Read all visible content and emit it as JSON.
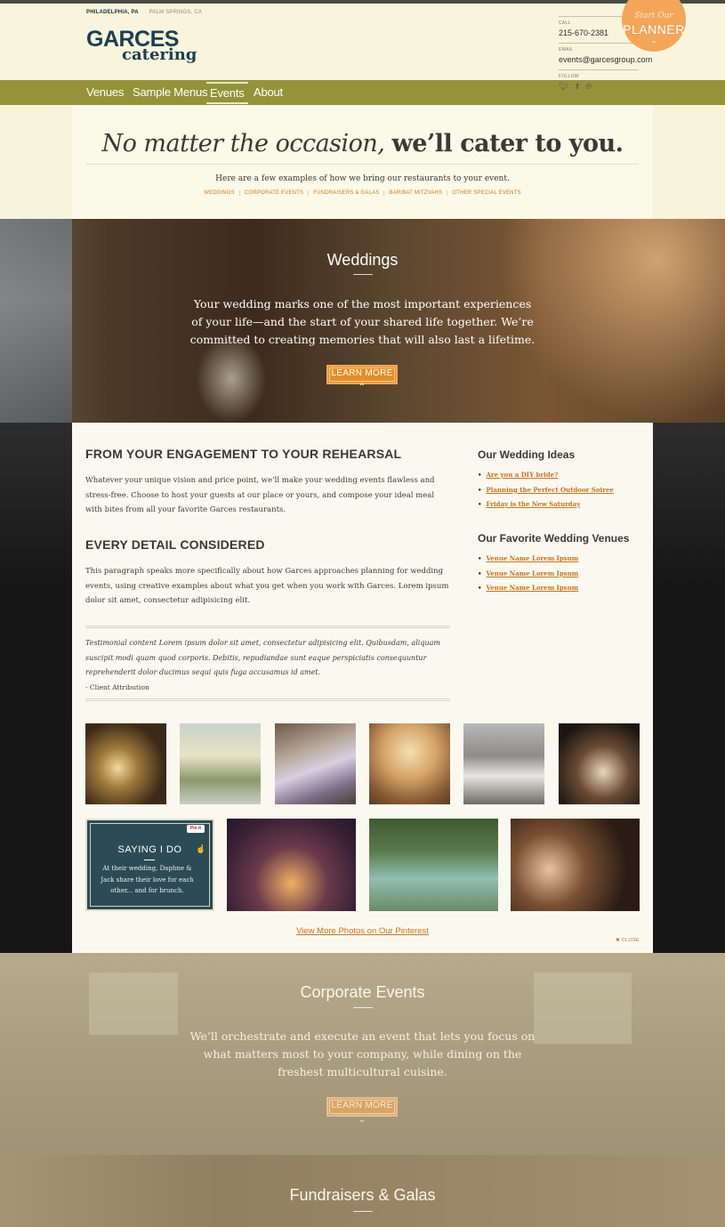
{
  "header": {
    "location_active": "PHILADELPHIA, PA",
    "location_other": "PALM SPRINGS, CA",
    "logo_line1": "GARCES",
    "logo_line2": "catering",
    "call_label": "CALL",
    "phone": "215-670-2381",
    "email_label": "EMAIL",
    "email": "events@garcesgroup.com",
    "follow_label": "FOLLOW",
    "social_icons": [
      "twitter-icon",
      "facebook-icon",
      "pinterest-icon"
    ],
    "planner": {
      "line1": "Start Our",
      "line2": "PLANNER",
      "arrow": "⌄"
    }
  },
  "nav": {
    "items": [
      "Venues",
      "Sample Menus",
      "Events",
      "About"
    ],
    "active": "Events"
  },
  "intro": {
    "headline_italic": "No matter the occasion,",
    "headline_bold": "we’ll cater to you.",
    "subtext": "Here are a few examples of how we bring our restaurants to your event.",
    "links": [
      "WEDDINGS",
      "CORPORATE EVENTS",
      "FUNDRAISERS & GALAS",
      "BAR/BAT MITZVAHS",
      "OTHER SPECIAL EVENTS"
    ]
  },
  "weddings": {
    "title": "Weddings",
    "body": "Your wedding marks one of the most important experiences of your life—and the start of your shared life together. We’re committed to creating memories that will also last a lifetime.",
    "button": "LEARN MORE ⌃",
    "section1_title": "FROM YOUR ENGAGEMENT TO YOUR REHEARSAL",
    "section1_body": "Whatever your unique vision and price point, we’ll make your wedding events flawless and stress-free. Choose to host your guests at our place or yours, and compose your ideal meal with bites from all your favorite Garces restaurants.",
    "section2_title": "EVERY DETAIL CONSIDERED",
    "section2_body": "This paragraph speaks more specifically about how Garces approaches planning for wedding events, using creative examples about what you get when you work with Garces. Lorem ipsum dolor sit amet, consectetur adipisicing elit.",
    "testimonial": "Testimonial content Lorem ipsum dolor sit amet, consectetur adipisicing elit. Quibusdam, aliquam suscipit modi quam quod corporis. Debitis, repudiandae sunt eaque perspiciatis consequuntur reprehenderit dolor ducimus sequi quis fuga accusamus id amet.",
    "attribution": "- Client Attribution",
    "ideas_title": "Our Wedding Ideas",
    "ideas": [
      "Are you a DIY bride?",
      "Planning the Perfect Outdoor Soiree",
      "Friday is the New Saturday"
    ],
    "venues_title": "Our Favorite Wedding Venues",
    "venues": [
      "Venue Name Lorem Ipsum",
      "Venue Name Lorem Ipsum",
      "Venue Name Lorem Ipsum"
    ],
    "pin_card": {
      "pinit": "Pin it",
      "title": "SAYING I DO",
      "desc": "At their wedding, Daphne & Jack share their love for each other... and for brunch."
    },
    "view_more": "View More Photos on Our Pinterest",
    "close": "✖ CLOSE"
  },
  "corporate": {
    "title": "Corporate Events",
    "body": "We’ll orchestrate and execute an event that lets you focus on what matters most to your company, while dining on the freshest multicultural cuisine.",
    "button": "LEARN MORE ⌄"
  },
  "fundraisers": {
    "title": "Fundraisers & Galas"
  }
}
